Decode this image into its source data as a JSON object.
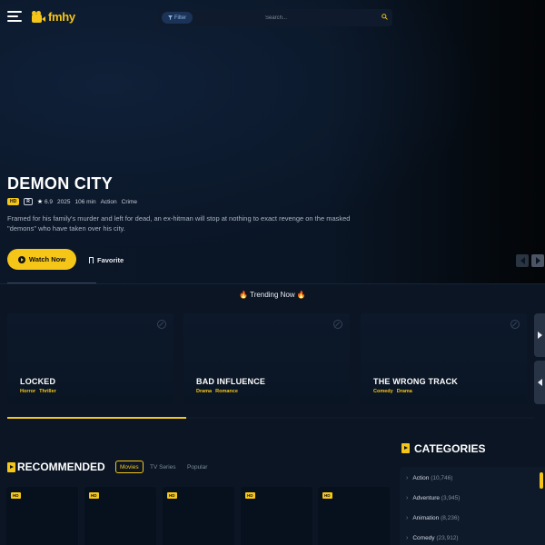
{
  "header": {
    "logo_text": "fmhy",
    "filter_label": "Filter",
    "search_placeholder": "Search..."
  },
  "hero": {
    "title": "DEMON CITY",
    "badge_hd": "HD",
    "badge_rating": "R",
    "score": "6.9",
    "year": "2025",
    "duration": "106 min",
    "genres": [
      "Action",
      "Crime"
    ],
    "description": "Framed for his family's murder and left for dead, an ex-hitman will stop at nothing to exact revenge on the masked \"demons\" who have taken over his city.",
    "watch_label": "Watch Now",
    "favorite_label": "Favorite"
  },
  "trending": {
    "title": "🔥 Trending Now 🔥",
    "progress": 0.34,
    "items": [
      {
        "title": "LOCKED",
        "genres": [
          "Horror",
          "Thriller"
        ]
      },
      {
        "title": "BAD INFLUENCE",
        "genres": [
          "Drama",
          "Romance"
        ]
      },
      {
        "title": "THE WRONG TRACK",
        "genres": [
          "Comedy",
          "Drama"
        ]
      }
    ]
  },
  "recommended": {
    "title": "RECOMMENDED",
    "tabs": [
      "Movies",
      "TV Series",
      "Popular"
    ],
    "active_tab": "Movies",
    "cards": [
      {
        "badge": "HD"
      },
      {
        "badge": "HD"
      },
      {
        "badge": "HD"
      },
      {
        "badge": "HD"
      },
      {
        "badge": "HD"
      }
    ]
  },
  "categories": {
    "title": "CATEGORIES",
    "items": [
      {
        "name": "Action",
        "count": "(10,746)"
      },
      {
        "name": "Adventure",
        "count": "(3,945)"
      },
      {
        "name": "Animation",
        "count": "(8,236)"
      },
      {
        "name": "Comedy",
        "count": "(23,912)"
      }
    ]
  },
  "colors": {
    "accent": "#f5c518",
    "background": "#0b1524"
  }
}
